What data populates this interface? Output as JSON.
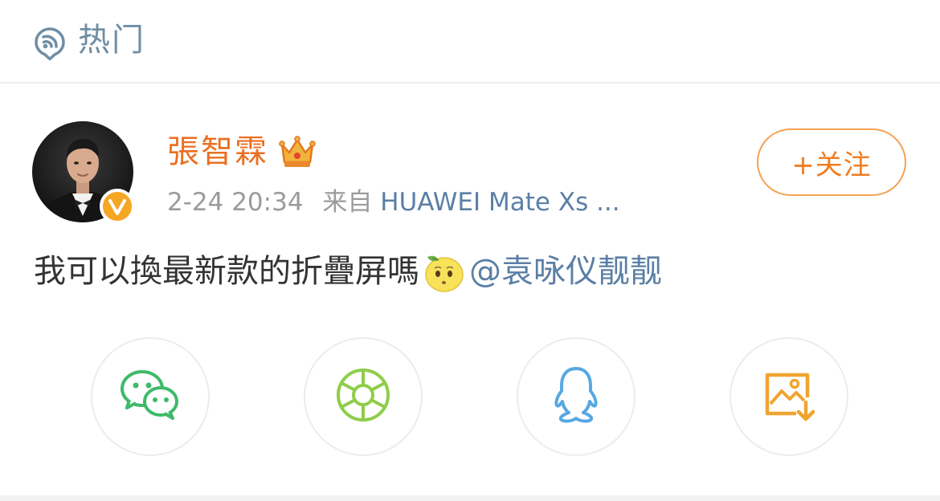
{
  "header": {
    "title": "热门",
    "icon": "trending-icon"
  },
  "post": {
    "author": {
      "name": "張智霖",
      "avatar": "avatar-photo",
      "verified": true,
      "badge_icon": "crown-icon"
    },
    "timestamp": "2-24 20:34",
    "source_prefix": "来自",
    "source": "HUAWEI Mate Xs ...",
    "follow_label": "+关注",
    "text": "我可以換最新款的折疊屏嗎",
    "emoji": "lemon-emoji",
    "mention": "@袁咏仪靓靓"
  },
  "share": [
    {
      "name": "wechat",
      "icon": "wechat-icon"
    },
    {
      "name": "moments",
      "icon": "moments-icon"
    },
    {
      "name": "qq",
      "icon": "qq-icon"
    },
    {
      "name": "save-image",
      "icon": "save-image-icon"
    }
  ],
  "colors": {
    "accent_orange": "#f07d22",
    "link_blue": "#5b7fa5",
    "wechat_green": "#3dba6a",
    "moments_green": "#8fcd4a",
    "qq_blue": "#57a8e3",
    "save_orange": "#f0a430"
  }
}
